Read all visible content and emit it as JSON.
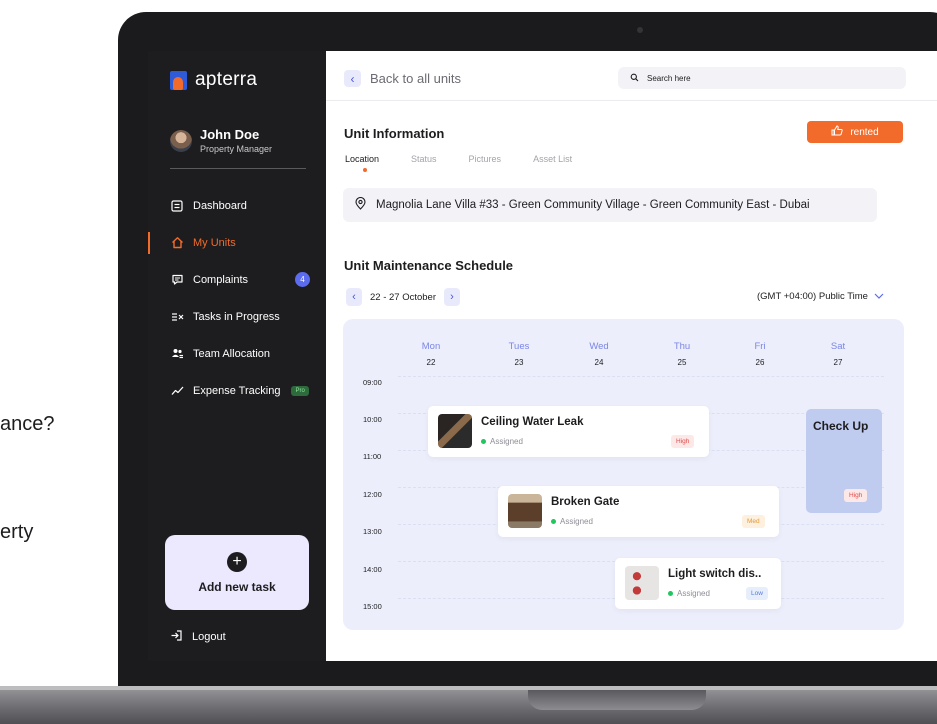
{
  "side_text": {
    "line1": "ance?",
    "line2": "erty"
  },
  "sidebar": {
    "brand": "apterra",
    "user": {
      "name": "John Doe",
      "role": "Property Manager"
    },
    "items": [
      {
        "label": "Dashboard",
        "icon": "dashboard-icon"
      },
      {
        "label": "My Units",
        "icon": "home-icon",
        "active": true
      },
      {
        "label": "Complaints",
        "icon": "chat-icon",
        "badge": "4"
      },
      {
        "label": "Tasks in Progress",
        "icon": "tasks-icon"
      },
      {
        "label": "Team Allocation",
        "icon": "team-icon"
      },
      {
        "label": "Expense Tracking",
        "icon": "trend-icon",
        "tag": "Pro"
      }
    ],
    "add_task": "Add new task",
    "logout": "Logout"
  },
  "topbar": {
    "back": "Back to all units",
    "search_placeholder": "Search here"
  },
  "unit": {
    "title": "Unit Information",
    "status": "rented",
    "tabs": [
      "Location",
      "Status",
      "Pictures",
      "Asset List"
    ],
    "active_tab": "Location",
    "address": "Magnolia Lane Villa #33 - Green Community Village - Green Community East - Dubai"
  },
  "schedule": {
    "title": "Unit Maintenance Schedule",
    "range": "22 - 27 October",
    "timezone": "(GMT +04:00) Public Time",
    "days": [
      {
        "name": "Mon",
        "num": "22"
      },
      {
        "name": "Tues",
        "num": "23"
      },
      {
        "name": "Wed",
        "num": "24"
      },
      {
        "name": "Thu",
        "num": "25"
      },
      {
        "name": "Fri",
        "num": "26"
      },
      {
        "name": "Sat",
        "num": "27"
      }
    ],
    "times": [
      "09:00",
      "10:00",
      "11:00",
      "12:00",
      "13:00",
      "14:00",
      "15:00"
    ],
    "events": [
      {
        "title": "Ceiling Water Leak",
        "status": "Assigned",
        "priority": "High"
      },
      {
        "title": "Broken Gate",
        "status": "Assigned",
        "priority": "Med"
      },
      {
        "title": "Light switch dis..",
        "status": "Assigned",
        "priority": "Low"
      }
    ],
    "checkup": {
      "title": "Check Up",
      "priority": "High"
    }
  },
  "colors": {
    "accent": "#f26b2b",
    "sidebar": "#1d1d1f",
    "brand_blue": "#2f5bd8",
    "calendar_bg": "#eceefb",
    "day_blue": "#7b86e6"
  }
}
